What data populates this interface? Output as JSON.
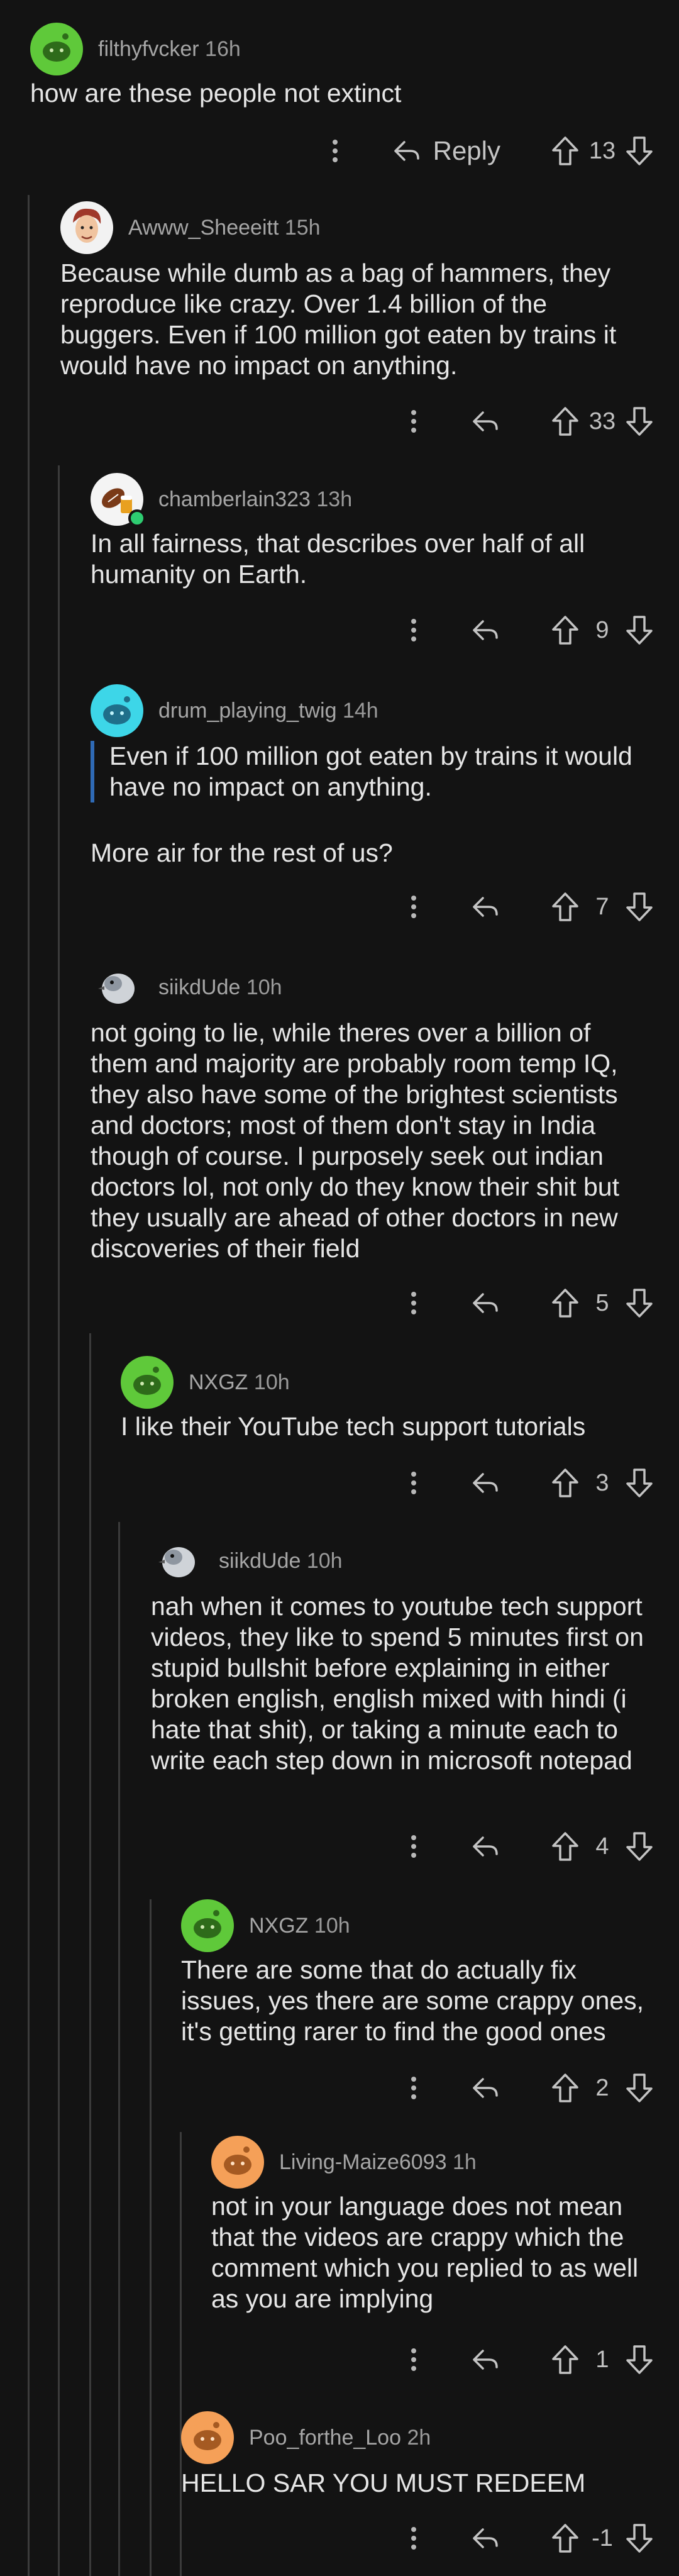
{
  "comments": [
    {
      "username": "filthyfvcker",
      "time": "16h",
      "text": "how are these people not extinct",
      "reply_label": "Reply",
      "votes": "13"
    },
    {
      "username": "Awww_Sheeeitt",
      "time": "15h",
      "text": "Because while dumb as a bag of hammers, they reproduce like crazy. Over 1.4 billion of the buggers. Even if 100 million got eaten by trains it would have no impact on anything.",
      "votes": "33"
    },
    {
      "username": "chamberlain323",
      "time": "13h",
      "text": "In all fairness, that describes over half of all humanity on Earth.",
      "votes": "9"
    },
    {
      "username": "drum_playing_twig",
      "time": "14h",
      "quote": "Even if 100 million got eaten by trains it would have no impact on anything.",
      "text": "More air for the rest of us?",
      "votes": "7"
    },
    {
      "username": "siikdUde",
      "time": "10h",
      "text": "not going to lie, while theres over a billion of them and majority are probably room temp IQ, they also have some of the brightest scientists and doctors; most of them don't stay in India though of course. I purposely seek out indian doctors lol, not only do they know their shit but they usually are ahead of other doctors in new discoveries of their field",
      "votes": "5"
    },
    {
      "username": "NXGZ",
      "time": "10h",
      "text": "I like their YouTube tech support tutorials",
      "votes": "3"
    },
    {
      "username": "siikdUde",
      "time": "10h",
      "text": "nah when it comes to youtube tech support videos, they like to spend 5 minutes first on stupid bullshit before explaining in either broken english, english mixed with hindi (i hate that shit), or taking a minute each to write each step down in microsoft notepad",
      "votes": "4"
    },
    {
      "username": "NXGZ",
      "time": "10h",
      "text": "There are some that do actually fix issues, yes there are some crappy ones, it's getting rarer to find the good ones",
      "votes": "2"
    },
    {
      "username": "Living-Maize6093",
      "time": "1h",
      "text": "not in your language does not mean that the videos are crappy which the comment which you replied to as well as you are implying",
      "votes": "1"
    },
    {
      "username": "Poo_forthe_Loo",
      "time": "2h",
      "text": "HELLO SAR YOU MUST REDEEM",
      "votes": "-1"
    }
  ],
  "icons": {
    "more": "more-options-icon",
    "reply": "reply-arrow-icon",
    "upvote": "upvote-arrow-icon",
    "downvote": "downvote-arrow-icon"
  },
  "colors": {
    "background": "#131313",
    "quote_bar": "#2f6ab5",
    "thread_line": "#3b3b3b"
  }
}
